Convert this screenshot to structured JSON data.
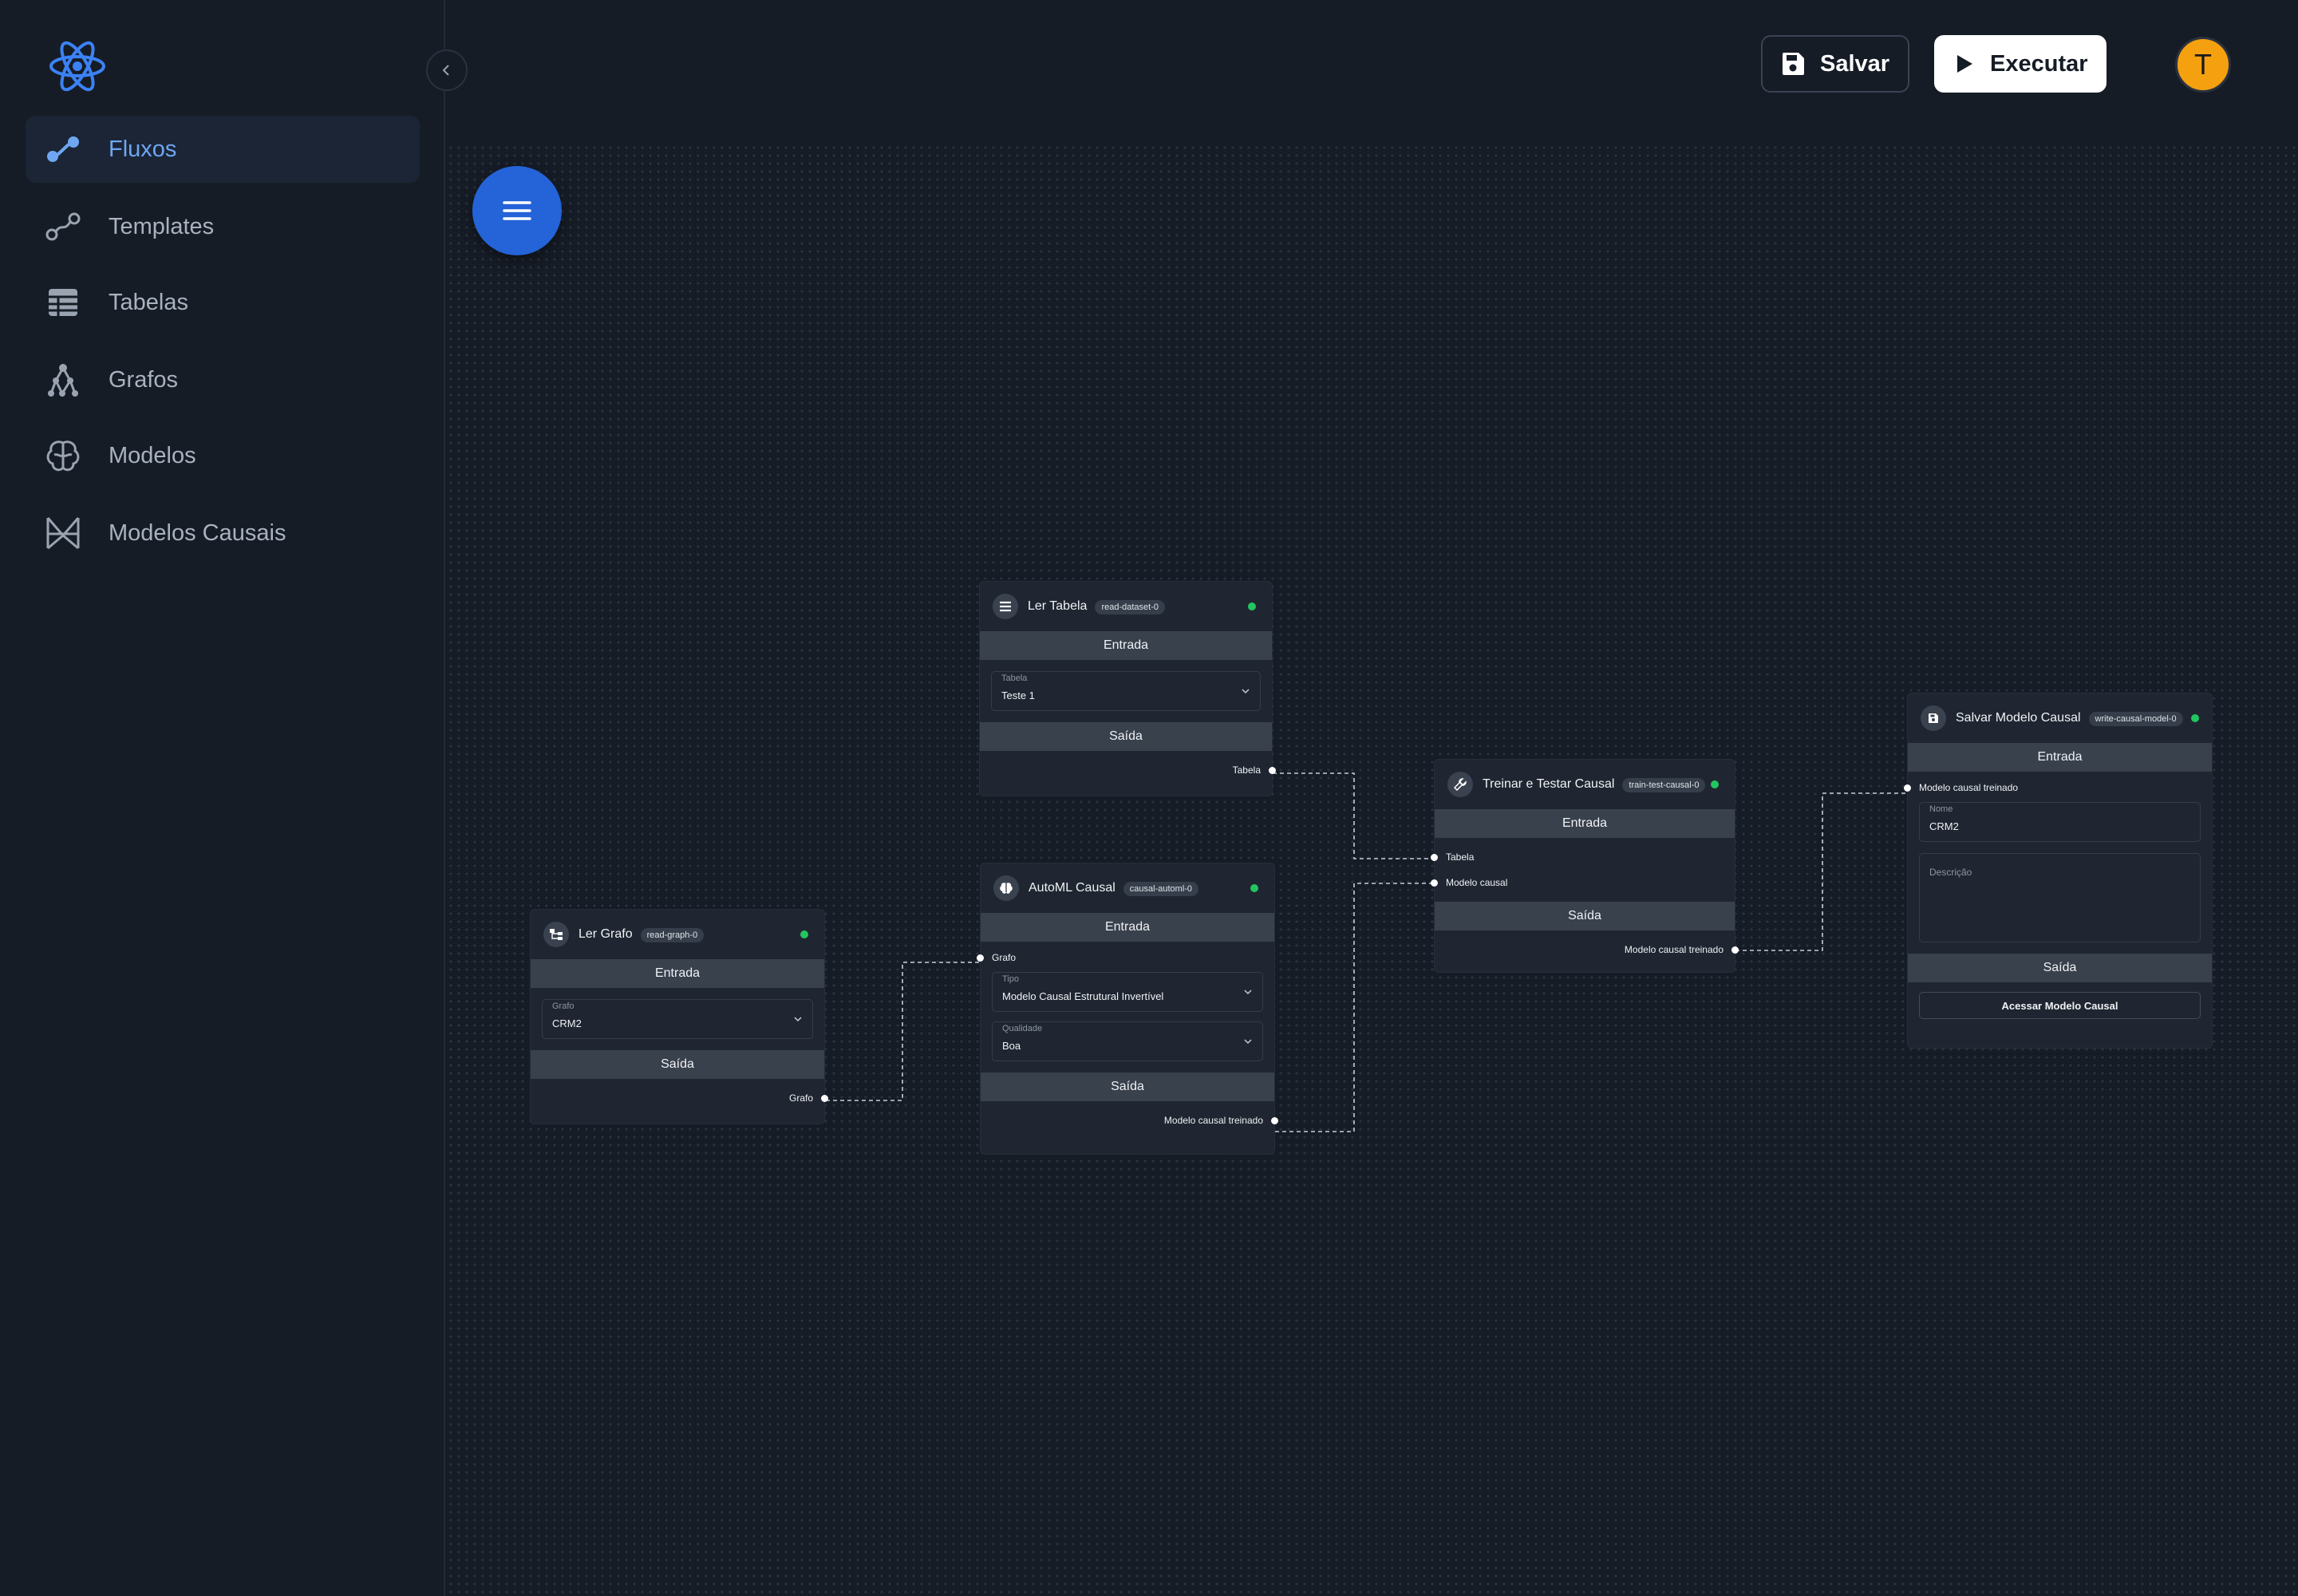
{
  "sidebar": {
    "items": [
      {
        "label": "Fluxos",
        "icon": "flow-icon",
        "active": true
      },
      {
        "label": "Templates",
        "icon": "template-icon"
      },
      {
        "label": "Tabelas",
        "icon": "table-icon"
      },
      {
        "label": "Grafos",
        "icon": "graph-icon"
      },
      {
        "label": "Modelos",
        "icon": "brain-icon"
      },
      {
        "label": "Modelos Causais",
        "icon": "causal-model-icon"
      }
    ]
  },
  "header": {
    "save_label": "Salvar",
    "run_label": "Executar",
    "avatar_initial": "T"
  },
  "colors": {
    "accent": "#2463d8",
    "active_nav": "#6fa6f2",
    "status_ok": "#22c55e",
    "avatar": "#f5a10f"
  },
  "nodes": {
    "read_table": {
      "title": "Ler Tabela",
      "badge": "read-dataset-0",
      "input_section": "Entrada",
      "output_section": "Saída",
      "field_label": "Tabela",
      "field_value": "Teste 1",
      "output_port": "Tabela"
    },
    "read_graph": {
      "title": "Ler Grafo",
      "badge": "read-graph-0",
      "input_section": "Entrada",
      "output_section": "Saída",
      "field_label": "Grafo",
      "field_value": "CRM2",
      "output_port": "Grafo"
    },
    "automl": {
      "title": "AutoML Causal",
      "badge": "causal-automl-0",
      "input_section": "Entrada",
      "output_section": "Saída",
      "input_port": "Grafo",
      "type_label": "Tipo",
      "type_value": "Modelo Causal Estrutural Invertível",
      "quality_label": "Qualidade",
      "quality_value": "Boa",
      "output_port": "Modelo causal treinado"
    },
    "train_test": {
      "title": "Treinar e Testar Causal",
      "badge": "train-test-causal-0",
      "input_section": "Entrada",
      "output_section": "Saída",
      "input_port_1": "Tabela",
      "input_port_2": "Modelo causal",
      "output_port": "Modelo causal treinado"
    },
    "save_model": {
      "title": "Salvar Modelo Causal",
      "badge": "write-causal-model-0",
      "input_section": "Entrada",
      "output_section": "Saída",
      "input_port": "Modelo causal treinado",
      "name_label": "Nome",
      "name_value": "CRM2",
      "desc_placeholder": "Descrição",
      "action_label": "Acessar Modelo Causal"
    }
  }
}
